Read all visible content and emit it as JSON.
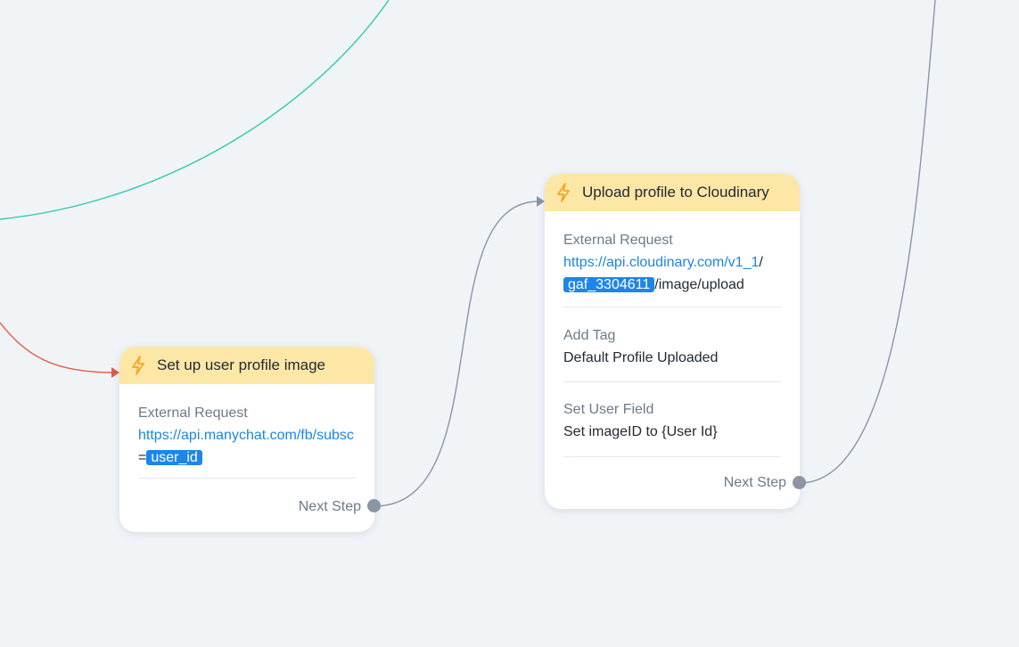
{
  "colors": {
    "canvas": "#f1f4f7",
    "header": "#fde7a6",
    "link": "#1a86e0",
    "variable_chip": "#1c86ea",
    "connector_gray": "#8b95a3",
    "connector_teal": "#2ec9b0",
    "connector_red": "#e05a45"
  },
  "node1": {
    "title": "Set up user profile image",
    "icon": "lightning-icon",
    "action": {
      "title": "External Request",
      "url": "https://api.manychat.com/fb/subsc",
      "prefix": "=",
      "variable": "user_id"
    },
    "next_step": "Next Step"
  },
  "node2": {
    "title": "Upload profile to Cloudinary",
    "icon": "lightning-icon",
    "actions": [
      {
        "title": "External Request",
        "url": "https://api.cloudinary.com/v1_1",
        "slash": "/",
        "variable": "gaf_3304611",
        "suffix": "/image/upload"
      },
      {
        "title": "Add Tag",
        "value": "Default Profile Uploaded"
      },
      {
        "title": "Set User Field",
        "value": "Set imageID to {User Id}"
      }
    ],
    "next_step": "Next Step"
  }
}
